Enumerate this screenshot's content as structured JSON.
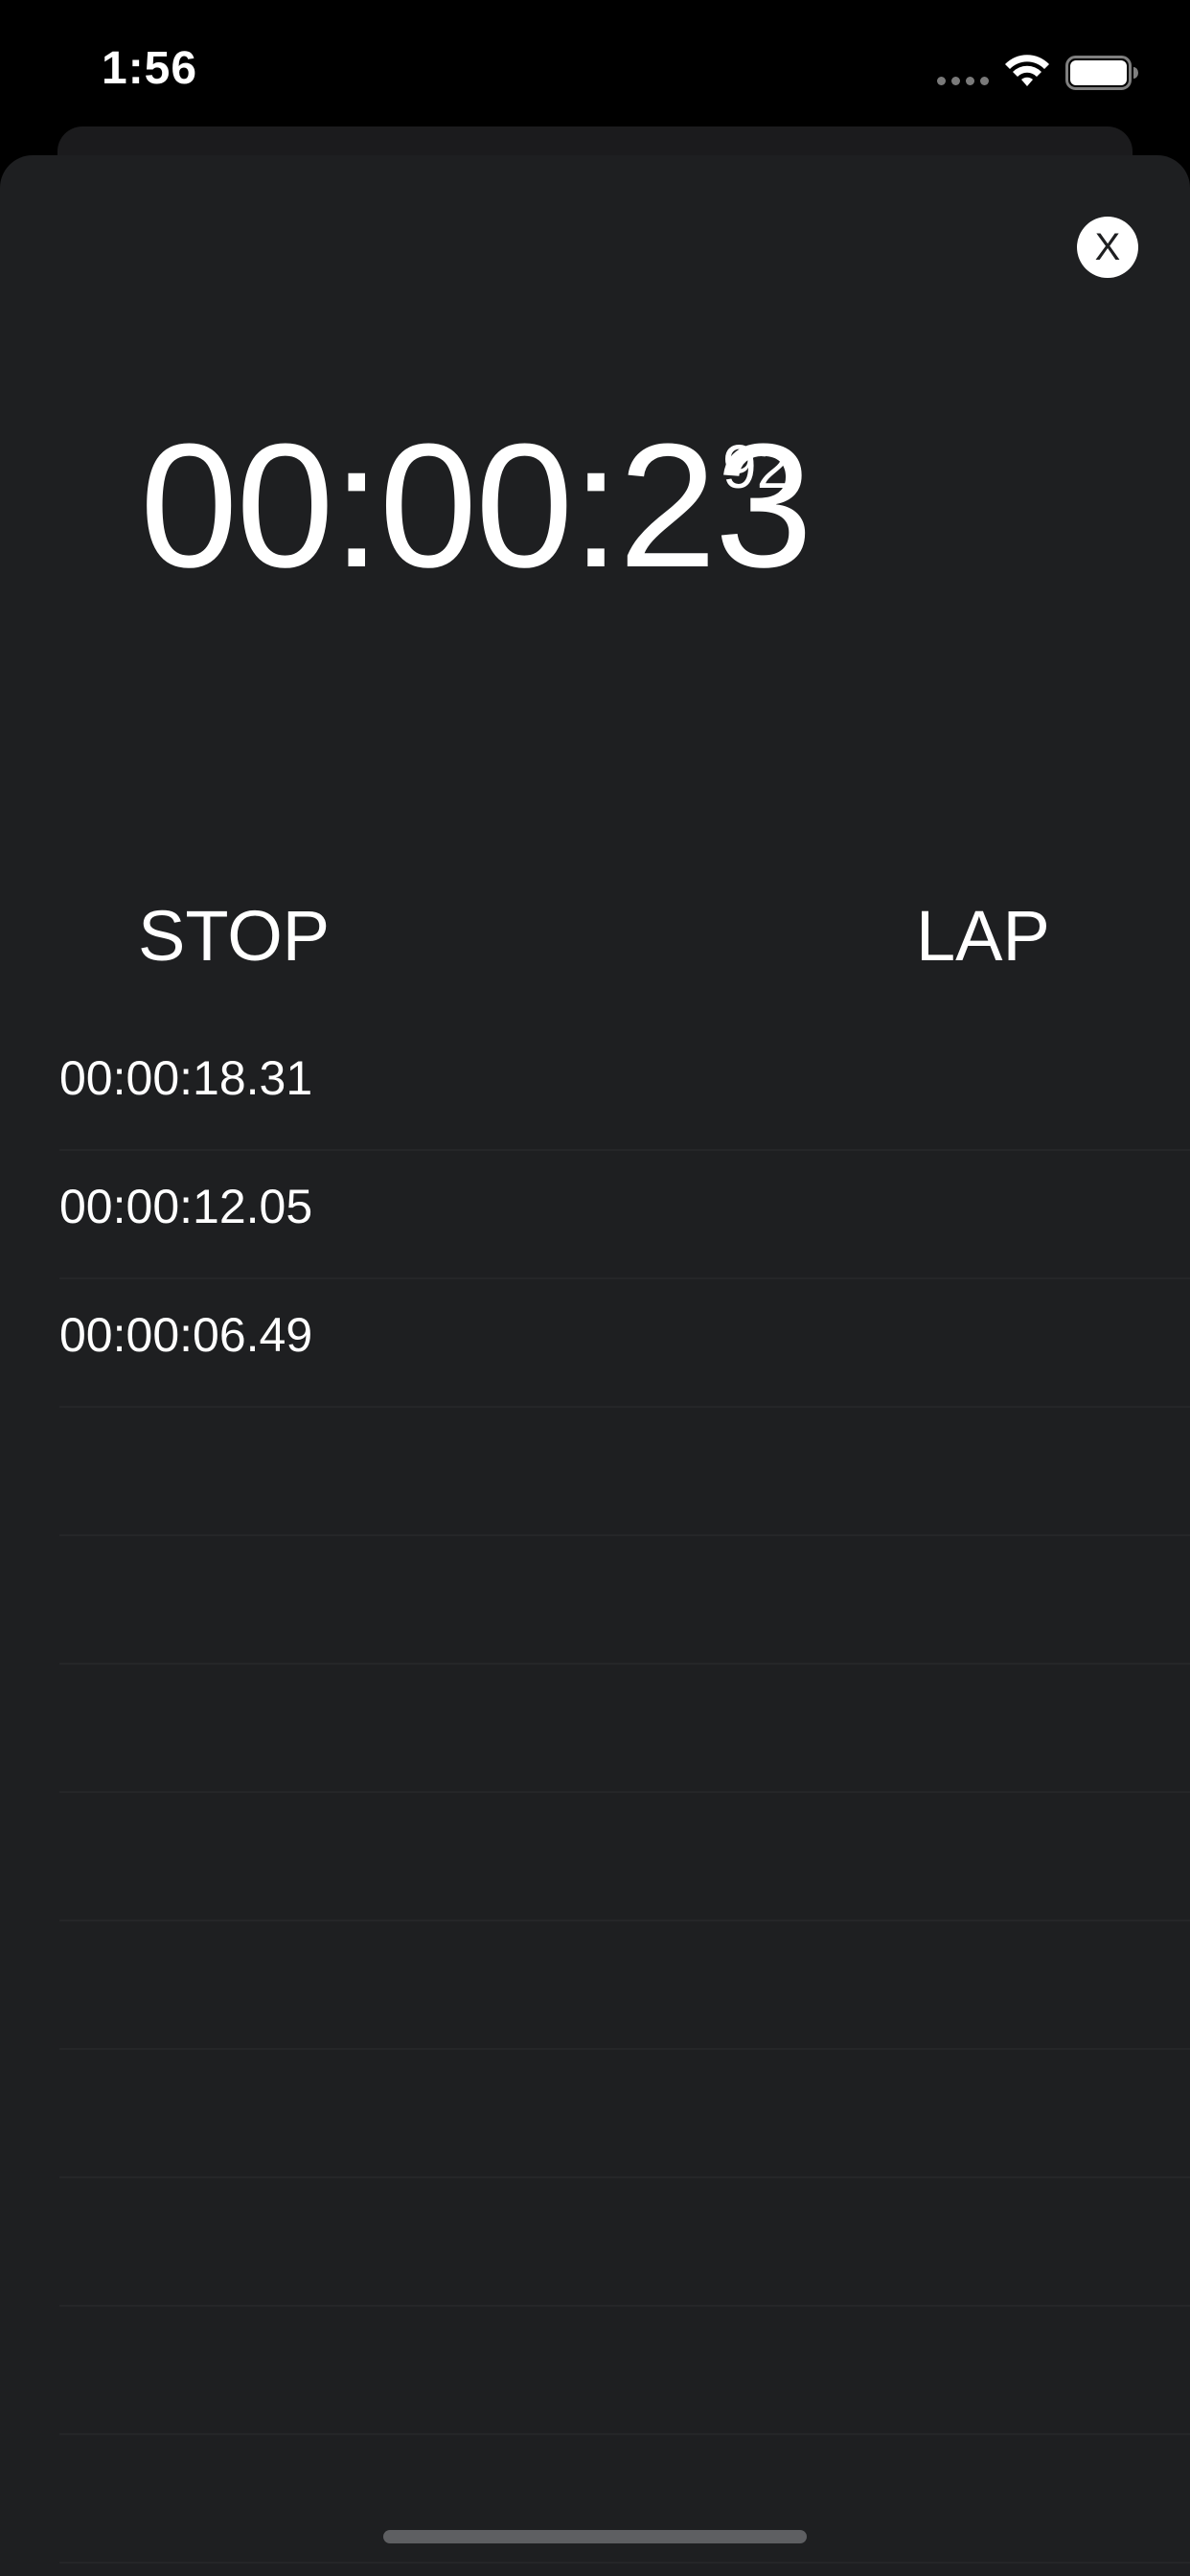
{
  "status_bar": {
    "time": "1:56",
    "icons": [
      "signal-dots-icon",
      "wifi-icon",
      "battery-icon"
    ]
  },
  "close_button": {
    "label": "X"
  },
  "timer": {
    "main": "00:00:23",
    "hundredths": "92"
  },
  "controls": {
    "stop_label": "STOP",
    "lap_label": "LAP"
  },
  "laps": [
    "00:00:18.31",
    "00:00:12.05",
    "00:00:06.49",
    "",
    "",
    "",
    "",
    "",
    "",
    "",
    "",
    "",
    ""
  ],
  "colors": {
    "background": "#000000",
    "sheet": "#1e1f21",
    "text": "#ffffff",
    "separator": "#252628"
  }
}
